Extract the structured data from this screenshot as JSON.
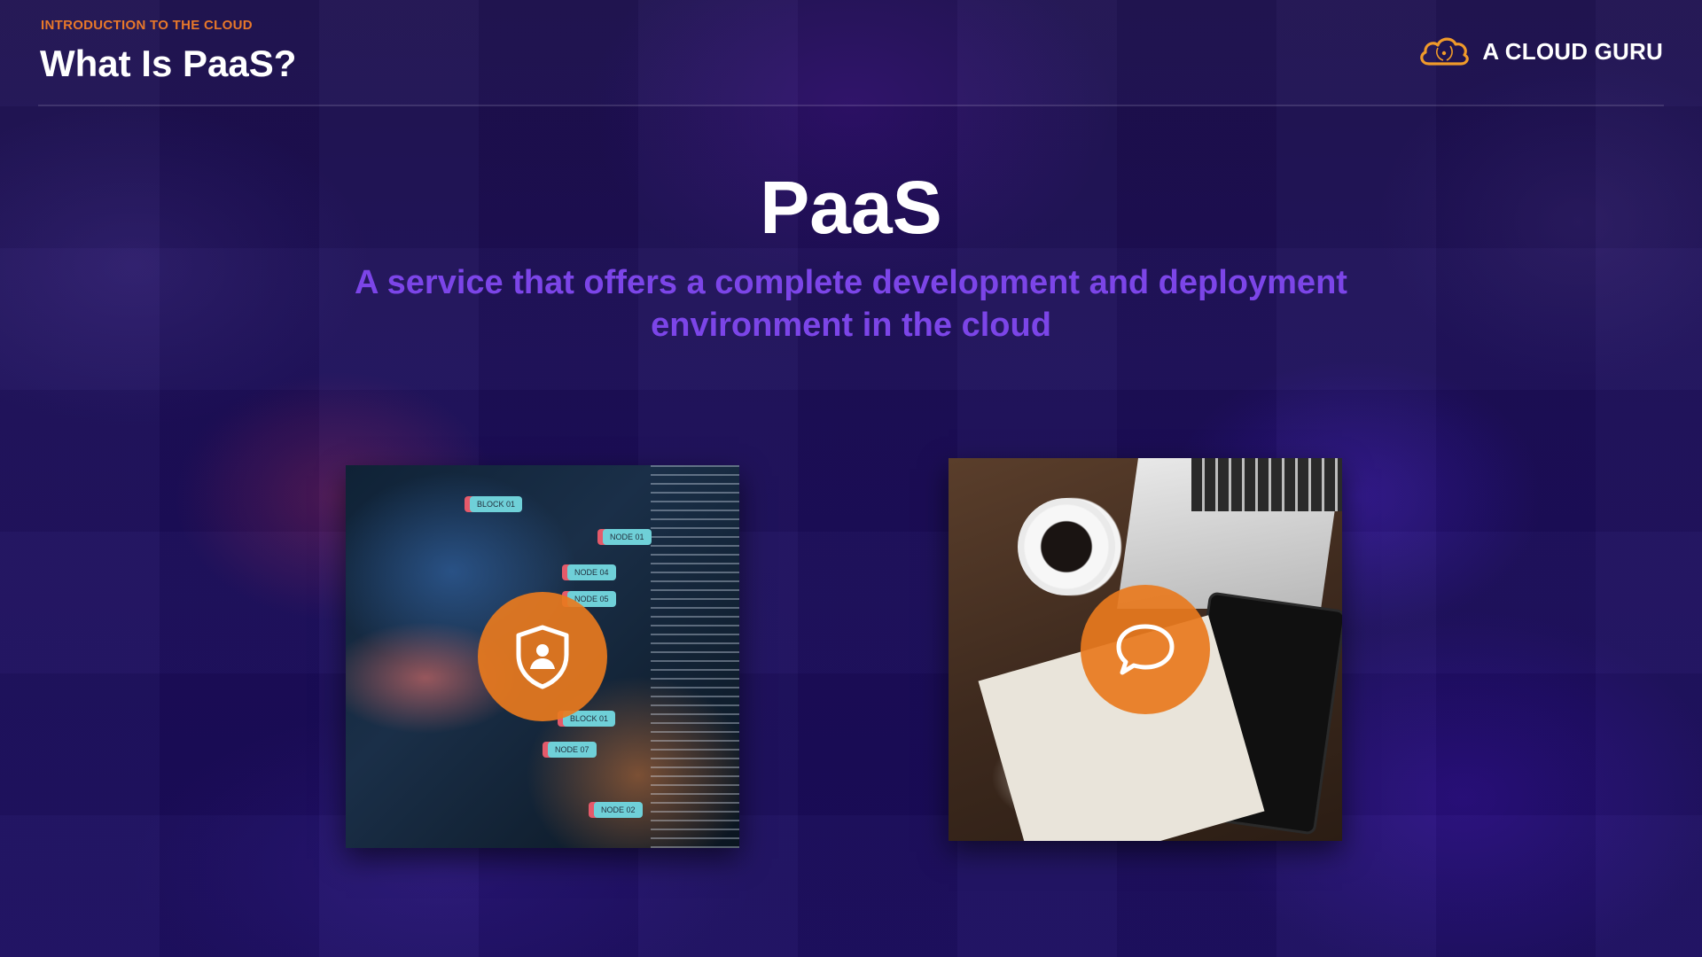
{
  "header": {
    "section_label": "INTRODUCTION TO THE CLOUD",
    "title": "What Is PaaS?",
    "brand_name": "A CLOUD GURU"
  },
  "hero": {
    "title": "PaaS",
    "subtitle": "A service that offers a complete development and deployment environment in the cloud"
  },
  "cards": [
    {
      "icon": "shield-user-icon",
      "tags": [
        "BLOCK 01",
        "NODE 01",
        "NODE 04",
        "NODE 05",
        "BLOCK 01",
        "NODE 07",
        "NODE 02"
      ]
    },
    {
      "icon": "chat-bubble-icon"
    }
  ],
  "colors": {
    "accent_orange": "#e8782a",
    "subtitle_purple": "#7c45e8",
    "background": "#1a0d4a",
    "badge_orange": "#e87a1e"
  }
}
